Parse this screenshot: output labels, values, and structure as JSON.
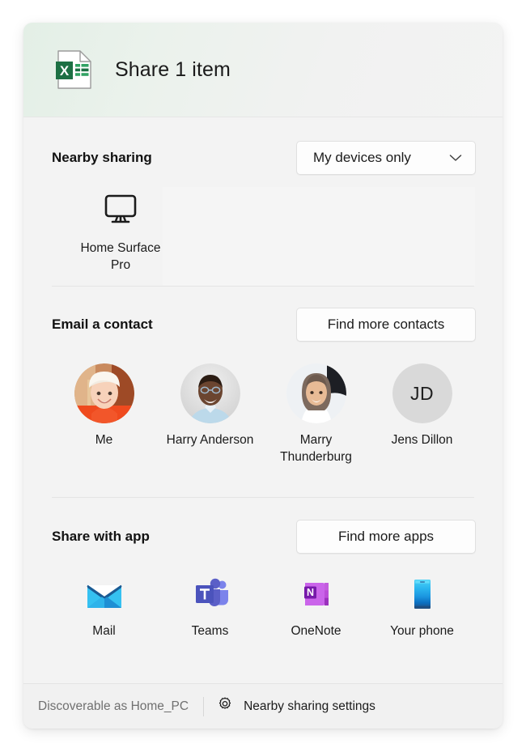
{
  "window": {
    "header": {
      "title": "Share 1 item",
      "file_icon": "excel-file-icon"
    }
  },
  "nearby_sharing": {
    "title": "Nearby sharing",
    "dropdown": {
      "value": "My devices only",
      "icon": "chevron-down-icon"
    },
    "devices": [
      {
        "name": "Home Surface Pro",
        "icon": "monitor-icon"
      }
    ]
  },
  "email_contact": {
    "title": "Email a contact",
    "button": "Find more contacts",
    "contacts": [
      {
        "name": "Me",
        "avatar_type": "photo",
        "initials": ""
      },
      {
        "name": "Harry Anderson",
        "avatar_type": "photo",
        "initials": ""
      },
      {
        "name": "Marry Thunderburg",
        "avatar_type": "photo",
        "initials": ""
      },
      {
        "name": "Jens Dillon",
        "avatar_type": "initials",
        "initials": "JD"
      }
    ]
  },
  "share_with_app": {
    "title": "Share with app",
    "button": "Find more apps",
    "apps": [
      {
        "name": "Mail",
        "icon": "mail-icon"
      },
      {
        "name": "Teams",
        "icon": "teams-icon"
      },
      {
        "name": "OneNote",
        "icon": "onenote-icon"
      },
      {
        "name": "Your phone",
        "icon": "phone-icon"
      }
    ]
  },
  "footer": {
    "status": "Discoverable as Home_PC",
    "settings_icon": "gear-icon",
    "settings_link": "Nearby sharing settings"
  },
  "colors": {
    "header_tint": "#e3efe6",
    "window_bg": "#f3f3f3",
    "excel_green": "#1d7044",
    "mail_blue": "#1490df",
    "teams_purple": "#5b5fc7",
    "onenote_purple": "#b557d8",
    "phone_blue": "#35c1f1"
  }
}
